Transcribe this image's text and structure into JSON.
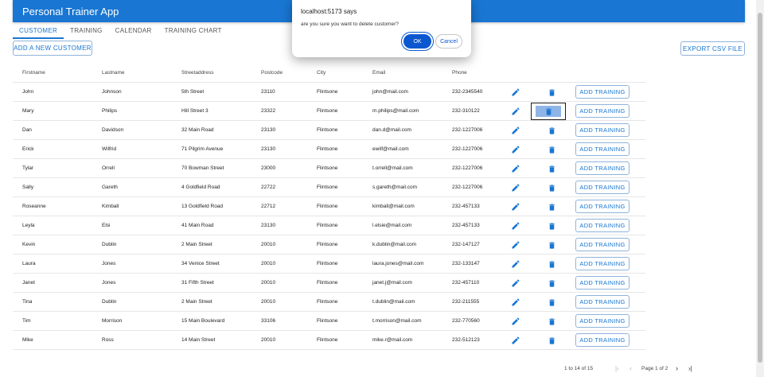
{
  "app": {
    "title": "Personal Trainer App"
  },
  "tabs": [
    {
      "label": "CUSTOMER",
      "active": true
    },
    {
      "label": "TRAINING",
      "active": false
    },
    {
      "label": "CALENDAR",
      "active": false
    },
    {
      "label": "TRAINING CHART",
      "active": false
    }
  ],
  "toolbar": {
    "add_customer": "ADD A NEW CUSTOMER",
    "export_csv": "EXPORT CSV FILE"
  },
  "table": {
    "headers": [
      "Firstname",
      "Lastname",
      "Streetaddress",
      "Postcode",
      "City",
      "Email",
      "Phone"
    ],
    "add_training_label": "ADD TRAINING",
    "rows": [
      {
        "firstname": "John",
        "lastname": "Johnson",
        "street": "5th Street",
        "postcode": "23110",
        "city": "Flintsone",
        "email": "john@mail.com",
        "phone": "232-2345540"
      },
      {
        "firstname": "Mary",
        "lastname": "Philips",
        "street": "Hill Street 3",
        "postcode": "23322",
        "city": "Flintsone",
        "email": "m.philips@mail.com",
        "phone": "232-310122"
      },
      {
        "firstname": "Dan",
        "lastname": "Davidson",
        "street": "32 Main Road",
        "postcode": "23130",
        "city": "Flintsone",
        "email": "dan.d@mail.com",
        "phone": "232-1227006"
      },
      {
        "firstname": "Erick",
        "lastname": "Wilfrid",
        "street": "71 Pilgrim Avenue",
        "postcode": "23130",
        "city": "Flintsone",
        "email": "ewilf@mail.com",
        "phone": "232-1227006"
      },
      {
        "firstname": "Tylar",
        "lastname": "Orrell",
        "street": "70 Bowman Street",
        "postcode": "23000",
        "city": "Flintsone",
        "email": "t.orrell@mail.com",
        "phone": "232-1227006"
      },
      {
        "firstname": "Sally",
        "lastname": "Gareth",
        "street": "4 Goldfield Road",
        "postcode": "22722",
        "city": "Flintsone",
        "email": "s.gareth@mail.com",
        "phone": "232-1227006"
      },
      {
        "firstname": "Roseanne",
        "lastname": "Kimball",
        "street": "13 Goldfield Road",
        "postcode": "22712",
        "city": "Flintsone",
        "email": "kimball@mail.com",
        "phone": "232-457133"
      },
      {
        "firstname": "Leyla",
        "lastname": "Elsi",
        "street": "41 Main Road",
        "postcode": "23130",
        "city": "Flintsone",
        "email": "l.elsie@mail.com",
        "phone": "232-457133"
      },
      {
        "firstname": "Kevin",
        "lastname": "Dublin",
        "street": "2 Main Street",
        "postcode": "20010",
        "city": "Flintsone",
        "email": "k.dublin@mail.com",
        "phone": "232-147127"
      },
      {
        "firstname": "Laura",
        "lastname": "Jones",
        "street": "34 Venice Street",
        "postcode": "20010",
        "city": "Flintsone",
        "email": "laura.jones@mail.com",
        "phone": "232-133147"
      },
      {
        "firstname": "Janet",
        "lastname": "Jones",
        "street": "31 Fifth Street",
        "postcode": "20010",
        "city": "Flintsone",
        "email": "janet.j@mail.com",
        "phone": "232-457110"
      },
      {
        "firstname": "Tina",
        "lastname": "Dublin",
        "street": "2 Main Street",
        "postcode": "20010",
        "city": "Flintsone",
        "email": "t.dublin@mail.com",
        "phone": "232-211555"
      },
      {
        "firstname": "Tim",
        "lastname": "Morrison",
        "street": "15 Main Boulevard",
        "postcode": "33106",
        "city": "Flintsone",
        "email": "t.morrison@mail.com",
        "phone": "232-770560"
      },
      {
        "firstname": "Mike",
        "lastname": "Ross",
        "street": "14 Main Street",
        "postcode": "20010",
        "city": "Flintsone",
        "email": "mike.r@mail.com",
        "phone": "232-512123"
      }
    ]
  },
  "pagination": {
    "range": "1 to 14 of 15",
    "page": "Page 1 of 2"
  },
  "dialog": {
    "title": "localhost:5173 says",
    "message": "are you sure you want to delete customer?",
    "ok": "OK",
    "cancel": "Cancel"
  },
  "colors": {
    "primary": "#1976d2",
    "dialog_button": "#0b57d0",
    "focus_fill": "#8fb4e6"
  },
  "icons": {
    "edit": "pencil-icon",
    "delete": "trash-icon",
    "first": "first-page-icon",
    "prev": "chevron-left-icon",
    "next": "chevron-right-icon",
    "last": "last-page-icon"
  },
  "focused_delete_row": 1
}
